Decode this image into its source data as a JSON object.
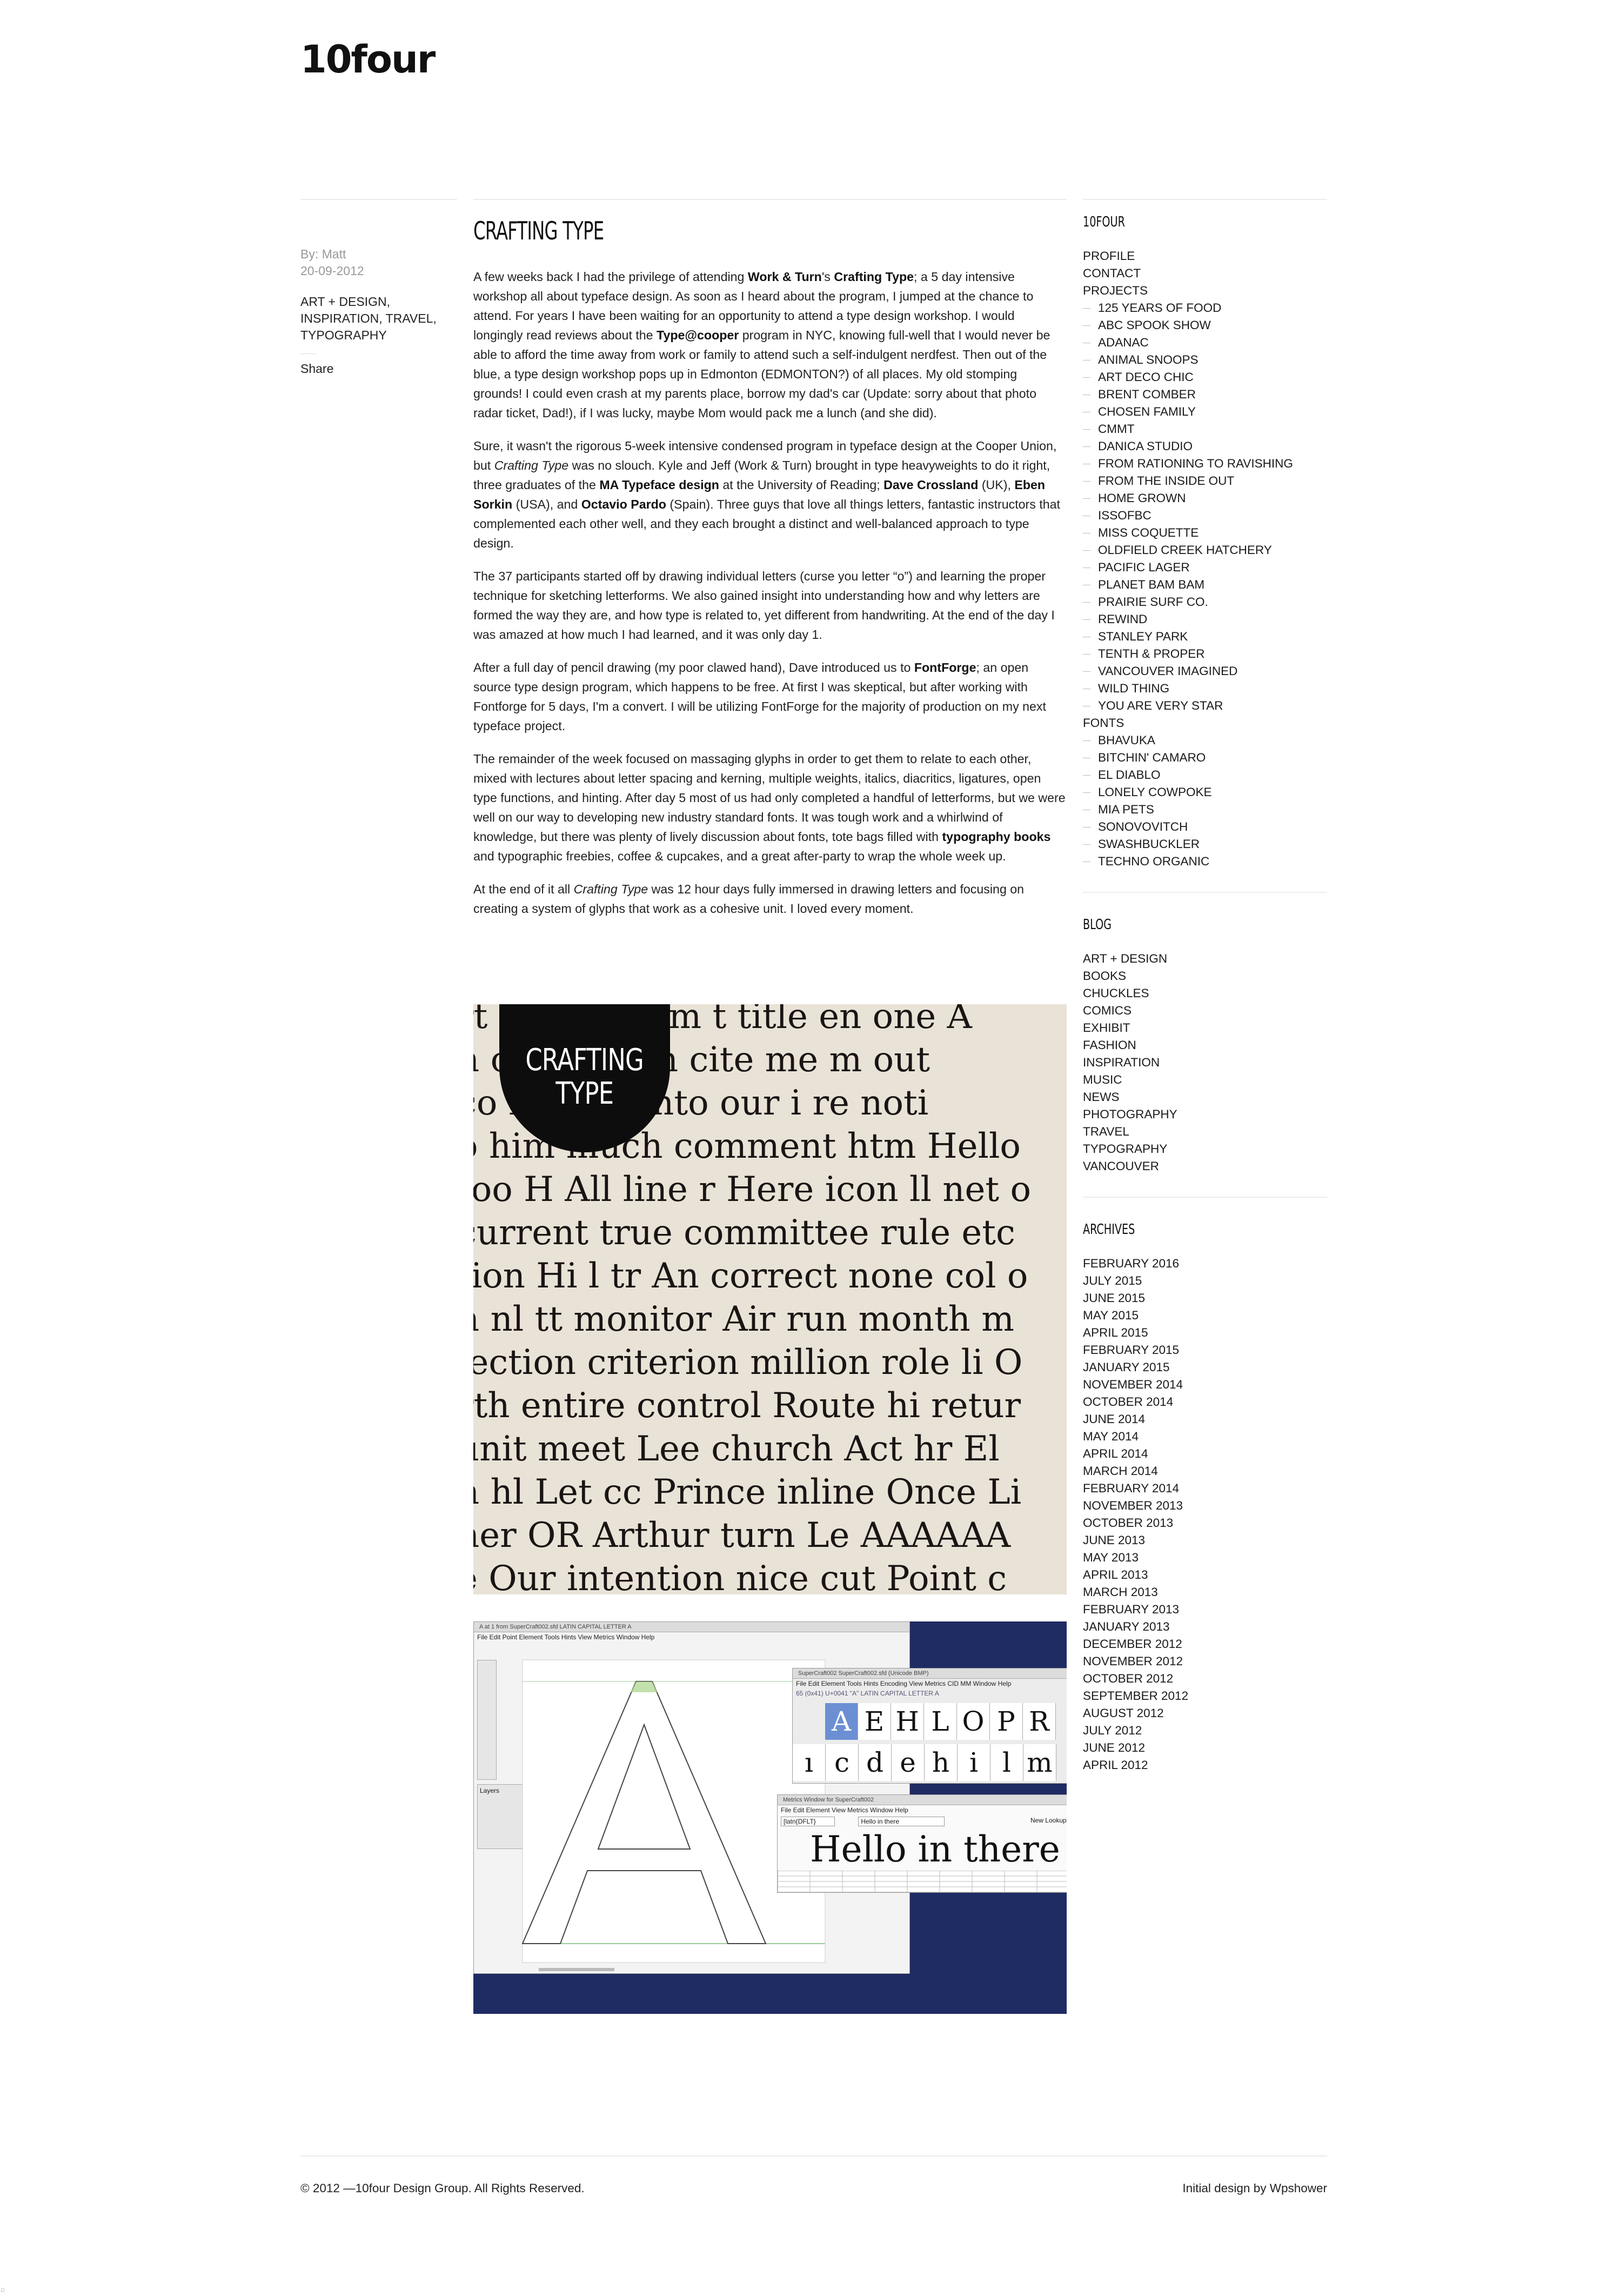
{
  "site": {
    "logo": "10four"
  },
  "meta": {
    "author": "By: Matt",
    "date": "20-09-2012",
    "categories": "ART + DESIGN, INSPIRATION, TRAVEL, TYPOGRAPHY",
    "share": "Share"
  },
  "post": {
    "title": "CRAFTING TYPE",
    "p1": {
      "a": "A few weeks back I had the privilege of attending ",
      "b1": "Work & Turn",
      "c": "'s ",
      "b2": "Crafting Type",
      "d": "; a 5 day intensive workshop all about typeface design. As soon as I heard about the program, I jumped at the chance to attend. For years I have been waiting for an opportunity to attend a type design workshop. I would longingly read reviews about the ",
      "b3": "Type@cooper",
      "e": " program in NYC, knowing full-well that I would never be able to afford the time away from work or family to attend such a self-indulgent nerdfest. Then out of the blue, a type design workshop pops up in Edmonton (EDMONTON?) of all places. My old stomping grounds! I could even crash at my parents place, borrow my dad's car (Update: sorry about that photo radar ticket, Dad!), if I was lucky, maybe Mom would pack me a lunch (and she did)."
    },
    "p2": {
      "a": "Sure, it wasn't the rigorous 5-week intensive condensed program in typeface design at the Cooper Union, but ",
      "i1": "Crafting Type",
      "b": " was no slouch. Kyle and Jeff (Work & Turn) brought in type heavyweights to do it right, three graduates of the ",
      "b1": "MA Typeface design",
      "c": " at the University of Reading; ",
      "b2": "Dave Crossland",
      "d": " (UK), ",
      "b3": "Eben Sorkin",
      "e": " (USA), and ",
      "b4": "Octavio Pardo",
      "f": " (Spain). Three guys that love all things letters, fantastic instructors that complemented each other well, and they each brought a distinct and well-balanced approach to type design."
    },
    "p3": "The 37 participants started off by drawing individual letters (curse you letter “o”) and learning the proper technique for sketching letterforms. We also gained insight into understanding how and why letters are formed the way they are, and how type is related to, yet different from handwriting. At the end of the day I was amazed at how much I had learned, and it was only day 1.",
    "p4": {
      "a": "After a full day of pencil drawing (my poor clawed hand), Dave introduced us to ",
      "b1": "FontForge",
      "b": "; an open source type design program, which happens to be free. At first I was skeptical, but after working with Fontforge for 5 days, I'm a convert. I will be utilizing FontForge for the majority of production on my next typeface project."
    },
    "p5": {
      "a": "The remainder of the week focused on massaging glyphs in order to get them to relate to each other, mixed with lectures about letter spacing and kerning, multiple weights, italics, diacritics, ligatures, open type functions, and hinting. After day 5 most of us had only completed a handful of letterforms, but we were well on our way to developing new industry standard fonts. It was tough work and a whirlwind of knowledge, but there was plenty of lively discussion about fonts, tote bags filled with ",
      "b1": "typography books",
      "b": " and typographic freebies, coffee & cupcakes, and a great after-party to wrap the whole week up."
    },
    "p6": {
      "a": "At the end of it all ",
      "i1": "Crafting Type",
      "b": " was 12 hour days fully immersed in drawing letters and focusing on creating a system of glyphs that work as a cohesive unit. I loved every moment."
    }
  },
  "image1": {
    "badge_line1": "CRAFTING",
    "badge_line2": "TYPE",
    "lines": [
      "rt n  or or com t title en one A",
      "n   of me then cite me m out",
      "co  he th e into our i re noti",
      "o  him much comment htm Hello",
      "too H All line r Here icon ll net o",
      "current true committee rule etc",
      "tion Hi l tr An correct none col o",
      "n nl tt monitor Air run month m",
      "lection criterion million role li O",
      "rth entire control Route hi retur",
      " unit meet Lee church Act hr El",
      "n hl Let cc Prince inline Once Li",
      "her OR Arthur turn Le AAAAAA",
      "e Our intention nice cut Point c"
    ]
  },
  "image2": {
    "win1_title": "A at 1 from SuperCraft002.sfd LATIN CAPITAL LETTER A",
    "win1_menu": "File  Edit  Point  Element  Tools  Hints  View  Metrics  Window  Help",
    "layers_label": "Layers",
    "win2_title": "SuperCraft002  SuperCraft002.sfd (Unicode BMP)",
    "win2_menu": "File  Edit  Element  Tools  Hints  Encoding  View  Metrics  CID  MM  Window  Help",
    "win2_glyphinfo": "65 (0x41) U+0041 \"A\" LATIN CAPITAL LETTER A",
    "row1": [
      "A",
      "E",
      "H",
      "L",
      "O",
      "P",
      "R"
    ],
    "row2": [
      "ı",
      "c",
      "d",
      "e",
      "h",
      "i",
      "l",
      "m"
    ],
    "win3_title": "Metrics Window for SuperCraft002",
    "win3_menu": "File  Edit  Element  View  Metrics  Window  Help",
    "win3_field1": "[latn{DFLT}",
    "win3_field2": "Hello in there",
    "win3_button": "New Lookup S",
    "hello_text": "Hello in there"
  },
  "sidebar": {
    "sections": [
      {
        "title": "10FOUR",
        "items": [
          {
            "label": "PROFILE",
            "sub": false
          },
          {
            "label": "CONTACT",
            "sub": false
          },
          {
            "label": "PROJECTS",
            "sub": false
          },
          {
            "label": "125 YEARS OF FOOD",
            "sub": true
          },
          {
            "label": "ABC SPOOK SHOW",
            "sub": true
          },
          {
            "label": "ADANAC",
            "sub": true
          },
          {
            "label": "ANIMAL SNOOPS",
            "sub": true
          },
          {
            "label": "ART DECO CHIC",
            "sub": true
          },
          {
            "label": "BRENT COMBER",
            "sub": true
          },
          {
            "label": "CHOSEN FAMILY",
            "sub": true
          },
          {
            "label": "CMMT",
            "sub": true
          },
          {
            "label": "DANICA STUDIO",
            "sub": true
          },
          {
            "label": "FROM RATIONING TO RAVISHING",
            "sub": true
          },
          {
            "label": "FROM THE INSIDE OUT",
            "sub": true
          },
          {
            "label": "HOME GROWN",
            "sub": true
          },
          {
            "label": "ISSOFBC",
            "sub": true
          },
          {
            "label": "MISS COQUETTE",
            "sub": true
          },
          {
            "label": "OLDFIELD CREEK HATCHERY",
            "sub": true
          },
          {
            "label": "PACIFIC LAGER",
            "sub": true
          },
          {
            "label": "PLANET BAM BAM",
            "sub": true
          },
          {
            "label": "PRAIRIE SURF CO.",
            "sub": true
          },
          {
            "label": "REWIND",
            "sub": true
          },
          {
            "label": "STANLEY PARK",
            "sub": true
          },
          {
            "label": "TENTH & PROPER",
            "sub": true
          },
          {
            "label": "VANCOUVER IMAGINED",
            "sub": true
          },
          {
            "label": "WILD THING",
            "sub": true
          },
          {
            "label": "YOU ARE VERY STAR",
            "sub": true
          },
          {
            "label": "FONTS",
            "sub": false
          },
          {
            "label": "BHAVUKA",
            "sub": true
          },
          {
            "label": "BITCHIN' CAMARO",
            "sub": true
          },
          {
            "label": "EL DIABLO",
            "sub": true
          },
          {
            "label": "LONELY COWPOKE",
            "sub": true
          },
          {
            "label": "MIA PETS",
            "sub": true
          },
          {
            "label": "SONOVOVITCH",
            "sub": true
          },
          {
            "label": "SWASHBUCKLER",
            "sub": true
          },
          {
            "label": "TECHNO ORGANIC",
            "sub": true
          }
        ]
      },
      {
        "title": "BLOG",
        "items": [
          {
            "label": "ART + DESIGN",
            "sub": false
          },
          {
            "label": "BOOKS",
            "sub": false
          },
          {
            "label": "CHUCKLES",
            "sub": false
          },
          {
            "label": "COMICS",
            "sub": false
          },
          {
            "label": "EXHIBIT",
            "sub": false
          },
          {
            "label": "FASHION",
            "sub": false
          },
          {
            "label": "INSPIRATION",
            "sub": false
          },
          {
            "label": "MUSIC",
            "sub": false
          },
          {
            "label": "NEWS",
            "sub": false
          },
          {
            "label": "PHOTOGRAPHY",
            "sub": false
          },
          {
            "label": "TRAVEL",
            "sub": false
          },
          {
            "label": "TYPOGRAPHY",
            "sub": false
          },
          {
            "label": "VANCOUVER",
            "sub": false
          }
        ]
      },
      {
        "title": "ARCHIVES",
        "items": [
          {
            "label": "FEBRUARY 2016",
            "sub": false
          },
          {
            "label": "JULY 2015",
            "sub": false
          },
          {
            "label": "JUNE 2015",
            "sub": false
          },
          {
            "label": "MAY 2015",
            "sub": false
          },
          {
            "label": "APRIL 2015",
            "sub": false
          },
          {
            "label": "FEBRUARY 2015",
            "sub": false
          },
          {
            "label": "JANUARY 2015",
            "sub": false
          },
          {
            "label": "NOVEMBER 2014",
            "sub": false
          },
          {
            "label": "OCTOBER 2014",
            "sub": false
          },
          {
            "label": "JUNE 2014",
            "sub": false
          },
          {
            "label": "MAY 2014",
            "sub": false
          },
          {
            "label": "APRIL 2014",
            "sub": false
          },
          {
            "label": "MARCH 2014",
            "sub": false
          },
          {
            "label": "FEBRUARY 2014",
            "sub": false
          },
          {
            "label": "NOVEMBER 2013",
            "sub": false
          },
          {
            "label": "OCTOBER 2013",
            "sub": false
          },
          {
            "label": "JUNE 2013",
            "sub": false
          },
          {
            "label": "MAY 2013",
            "sub": false
          },
          {
            "label": "APRIL 2013",
            "sub": false
          },
          {
            "label": "MARCH 2013",
            "sub": false
          },
          {
            "label": "FEBRUARY 2013",
            "sub": false
          },
          {
            "label": "JANUARY 2013",
            "sub": false
          },
          {
            "label": "DECEMBER 2012",
            "sub": false
          },
          {
            "label": "NOVEMBER 2012",
            "sub": false
          },
          {
            "label": "OCTOBER 2012",
            "sub": false
          },
          {
            "label": "SEPTEMBER 2012",
            "sub": false
          },
          {
            "label": "AUGUST 2012",
            "sub": false
          },
          {
            "label": "JULY 2012",
            "sub": false
          },
          {
            "label": "JUNE 2012",
            "sub": false
          },
          {
            "label": "APRIL 2012",
            "sub": false
          }
        ]
      }
    ]
  },
  "footer": {
    "copyright": "© 2012 —10four Design Group. All Rights Reserved.",
    "credit": "Initial design by Wpshower"
  },
  "corner_mark": "□"
}
